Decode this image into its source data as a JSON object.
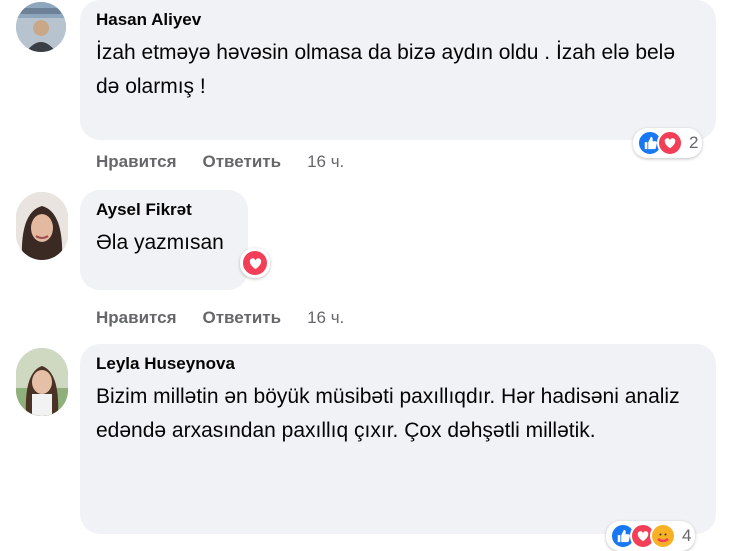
{
  "comments": [
    {
      "author": "Hasan Aliyev",
      "text": "İzah etməyə həvəsin olmasa da bizə aydın oldu . İzah elə belə də olarmış !",
      "reaction_count": "2",
      "actions": {
        "like": "Нравится",
        "reply": "Ответить",
        "time": "16 ч."
      }
    },
    {
      "author": "Aysel Fikrət",
      "text": "Əla yazmısan",
      "actions": {
        "like": "Нравится",
        "reply": "Ответить",
        "time": "16 ч."
      }
    },
    {
      "author": "Leyla Huseynova",
      "text": "Bizim millətin ən böyük müsibəti paxıllıqdır. Hər hadisəni analiz edəndə arxasından paxıllıq çıxır. Çox dəhşətli millətik.",
      "reaction_count": "4"
    }
  ],
  "colors": {
    "bubble": "#f0f2f5",
    "like": "#1877f2",
    "love": "#f33e58",
    "care": "#f7b125",
    "meta": "#65676b"
  }
}
